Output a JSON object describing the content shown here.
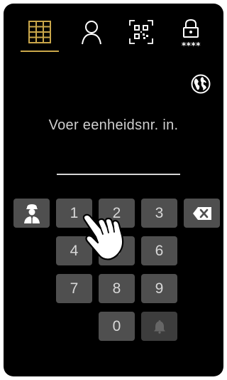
{
  "tabs": [
    {
      "name": "keypad",
      "icon": "keypad-grid-icon"
    },
    {
      "name": "contacts",
      "icon": "person-icon"
    },
    {
      "name": "qr-code",
      "icon": "qr-code-icon"
    },
    {
      "name": "pin-code",
      "icon": "lock-pin-icon",
      "label": "****"
    }
  ],
  "active_tab": "keypad",
  "colors": {
    "accent": "#c9a64a",
    "key_bg": "#4f4f4f",
    "screen_bg": "#000000"
  },
  "language_icon": "globe-icon",
  "prompt": "Voer eenheidsnr. in.",
  "entry_value": "",
  "keypad": {
    "concierge_icon": "concierge-icon",
    "keys": [
      "1",
      "2",
      "3",
      "4",
      "5",
      "6",
      "7",
      "8",
      "9",
      "0"
    ],
    "backspace_icon": "backspace-icon",
    "bell_icon": "bell-icon"
  },
  "overlay": {
    "icon": "tap-hand-icon"
  }
}
